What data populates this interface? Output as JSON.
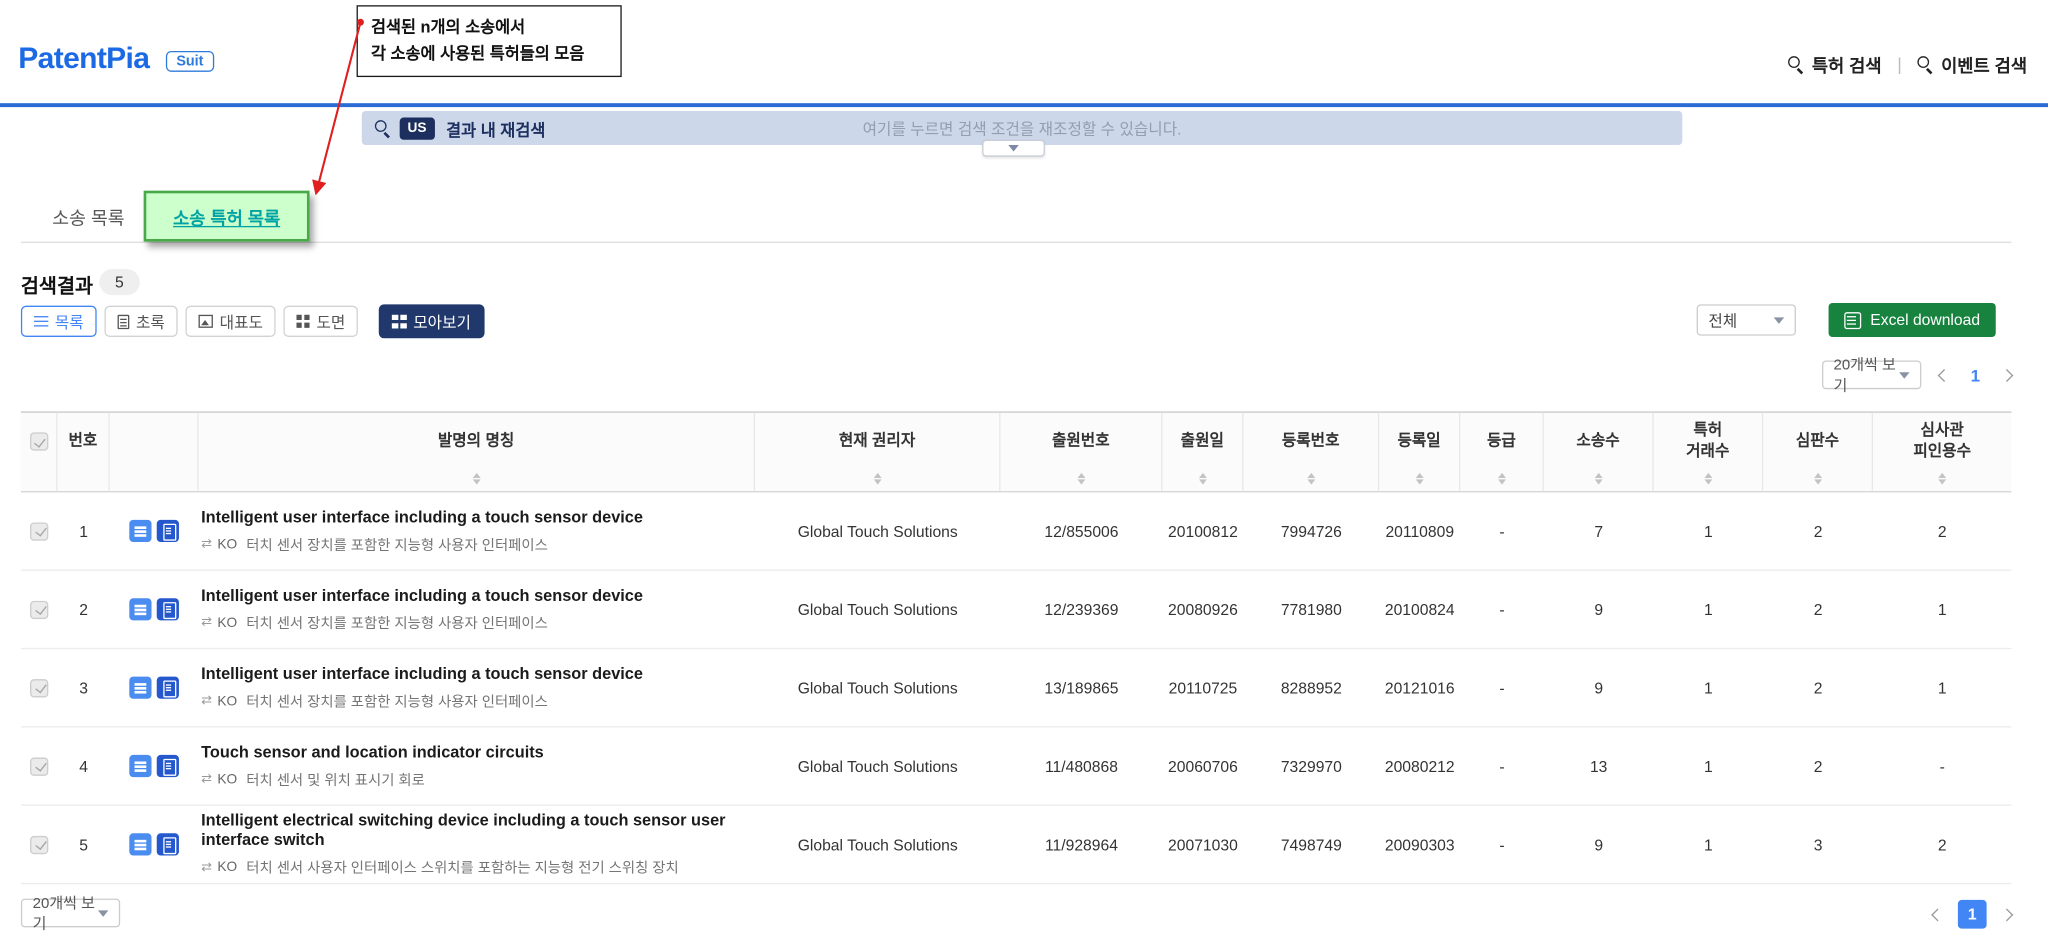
{
  "icons": {
    "translate": "⇄"
  },
  "annotation": {
    "line1": "검색된 n개의 소송에서",
    "line2": "각 소송에 사용된 특허들의 모음"
  },
  "header": {
    "logo": "PatentPia",
    "badge": "Suit",
    "nav_patent": "특허 검색",
    "nav_separator": "|",
    "nav_event": "이벤트 검색"
  },
  "search": {
    "country": "US",
    "label": "결과 내 재검색",
    "placeholder": "여기를 누르면 검색 조건을 재조정할 수 있습니다."
  },
  "tabs": {
    "suit_list": "소송 목록",
    "suit_patent_list": "소송 특허 목록"
  },
  "results": {
    "label": "검색결과",
    "count": "5"
  },
  "toolbar": {
    "list": "목록",
    "abstract": "초록",
    "rep_drawing": "대표도",
    "drawing": "도면",
    "collect": "모아보기",
    "filter_all": "전체",
    "excel": "Excel download"
  },
  "pagination": {
    "page_size": "20개씩 보기",
    "page": "1"
  },
  "table": {
    "ko_badge": "KO",
    "headers": {
      "no": "번호",
      "title": "발명의 명칭",
      "holder": "현재 권리자",
      "app_no": "출원번호",
      "app_date": "출원일",
      "reg_no": "등록번호",
      "reg_date": "등록일",
      "grade": "등급",
      "suits": "소송수",
      "deals": "특허\n거래수",
      "trials": "심판수",
      "citations": "심사관\n피인용수"
    },
    "rows": [
      {
        "no": "1",
        "title": "Intelligent user interface including a touch sensor device",
        "title_ko": "터치 센서 장치를 포함한 지능형 사용자 인터페이스",
        "holder": "Global Touch Solutions",
        "app_no": "12/855006",
        "app_date": "20100812",
        "reg_no": "7994726",
        "reg_date": "20110809",
        "grade": "-",
        "suits": "7",
        "deals": "1",
        "trials": "2",
        "citations": "2"
      },
      {
        "no": "2",
        "title": "Intelligent user interface including a touch sensor device",
        "title_ko": "터치 센서 장치를 포함한 지능형 사용자 인터페이스",
        "holder": "Global Touch Solutions",
        "app_no": "12/239369",
        "app_date": "20080926",
        "reg_no": "7781980",
        "reg_date": "20100824",
        "grade": "-",
        "suits": "9",
        "deals": "1",
        "trials": "2",
        "citations": "1"
      },
      {
        "no": "3",
        "title": "Intelligent user interface including a touch sensor device",
        "title_ko": "터치 센서 장치를 포함한 지능형 사용자 인터페이스",
        "holder": "Global Touch Solutions",
        "app_no": "13/189865",
        "app_date": "20110725",
        "reg_no": "8288952",
        "reg_date": "20121016",
        "grade": "-",
        "suits": "9",
        "deals": "1",
        "trials": "2",
        "citations": "1"
      },
      {
        "no": "4",
        "title": "Touch sensor and location indicator circuits",
        "title_ko": "터치 센서 및 위치 표시기 회로",
        "holder": "Global Touch Solutions",
        "app_no": "11/480868",
        "app_date": "20060706",
        "reg_no": "7329970",
        "reg_date": "20080212",
        "grade": "-",
        "suits": "13",
        "deals": "1",
        "trials": "2",
        "citations": "-"
      },
      {
        "no": "5",
        "title": "Intelligent electrical switching device including a touch sensor user interface switch",
        "title_ko": "터치 센서 사용자 인터페이스 스위치를 포함하는 지능형 전기 스위칭 장치",
        "holder": "Global Touch Solutions",
        "app_no": "11/928964",
        "app_date": "20071030",
        "reg_no": "7498749",
        "reg_date": "20090303",
        "grade": "-",
        "suits": "9",
        "deals": "1",
        "trials": "3",
        "citations": "2"
      }
    ]
  }
}
